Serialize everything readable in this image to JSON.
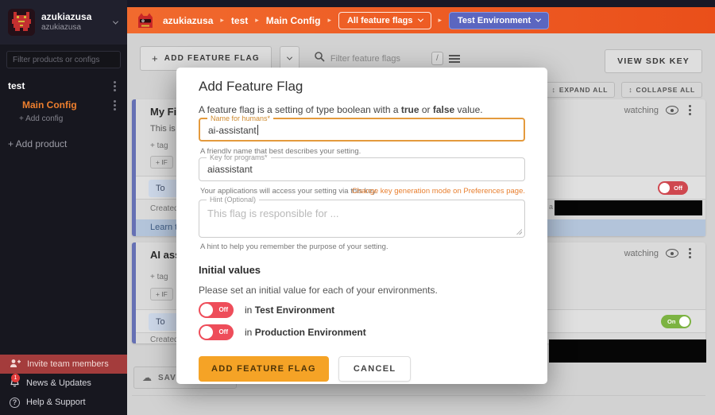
{
  "sidebar": {
    "org_name": "azukiazusa",
    "org_subtitle": "azukiazusa",
    "filter_placeholder": "Filter products or configs",
    "product_name": "test",
    "config_name": "Main Config",
    "add_config_label": "+ Add config",
    "add_product_label": "+ Add product",
    "invite_label": "Invite team members",
    "news_label": "News & Updates",
    "news_badge": "1",
    "help_label": "Help & Support"
  },
  "header": {
    "breadcrumb_org": "azukiazusa",
    "breadcrumb_product": "test",
    "breadcrumb_config": "Main Config",
    "flag_filter_label": "All feature flags",
    "environment_label": "Test Environment"
  },
  "toolbar": {
    "add_flag_label": "ADD FEATURE FLAG",
    "search_placeholder": "Filter feature flags",
    "shortcut_key": "/",
    "view_sdk_label": "VIEW SDK KEY",
    "expand_all_label": "EXPAND ALL",
    "collapse_all_label": "COLLAPSE ALL"
  },
  "flags": [
    {
      "title": "My Fir",
      "description": "This is y",
      "add_tag": "+ tag",
      "add_rule": "+ IF",
      "serve_prefix": "To",
      "created_label": "Created",
      "created_fragment": "y a",
      "watching_label": "watching",
      "toggle_state": "Off",
      "learn_label": "Learn t"
    },
    {
      "title": "AI ass",
      "add_tag": "+ tag",
      "add_rule": "+ IF",
      "serve_prefix": "To",
      "created_label": "Created",
      "watching_label": "watching",
      "toggle_state": "On"
    }
  ],
  "save_label": "SAVE",
  "modal": {
    "title": "Add Feature Flag",
    "description": {
      "pre": "A feature flag is a setting of type boolean with a ",
      "bold1": "true",
      "mid": " or ",
      "bold2": "false",
      "post": " value."
    },
    "name_field": {
      "label": "Name for humans*",
      "value": "ai-assistant",
      "helper": "A friendly name that best describes your setting."
    },
    "key_field": {
      "label": "Key for programs*",
      "value": "aiassistant",
      "helper": "Your applications will access your setting via this key.",
      "link": "Change key generation mode on Preferences page."
    },
    "hint_field": {
      "label": "Hint (Optional)",
      "placeholder": "This flag is responsible for ...",
      "helper": "A hint to help you remember the purpose of your setting."
    },
    "initial_values": {
      "heading": "Initial values",
      "description": "Please set an initial value for each of your environments.",
      "toggles": [
        {
          "state": "Off",
          "prefix": "in",
          "env": "Test Environment"
        },
        {
          "state": "Off",
          "prefix": "in",
          "env": "Production Environment"
        }
      ]
    },
    "submit_label": "ADD FEATURE FLAG",
    "cancel_label": "CANCEL"
  }
}
